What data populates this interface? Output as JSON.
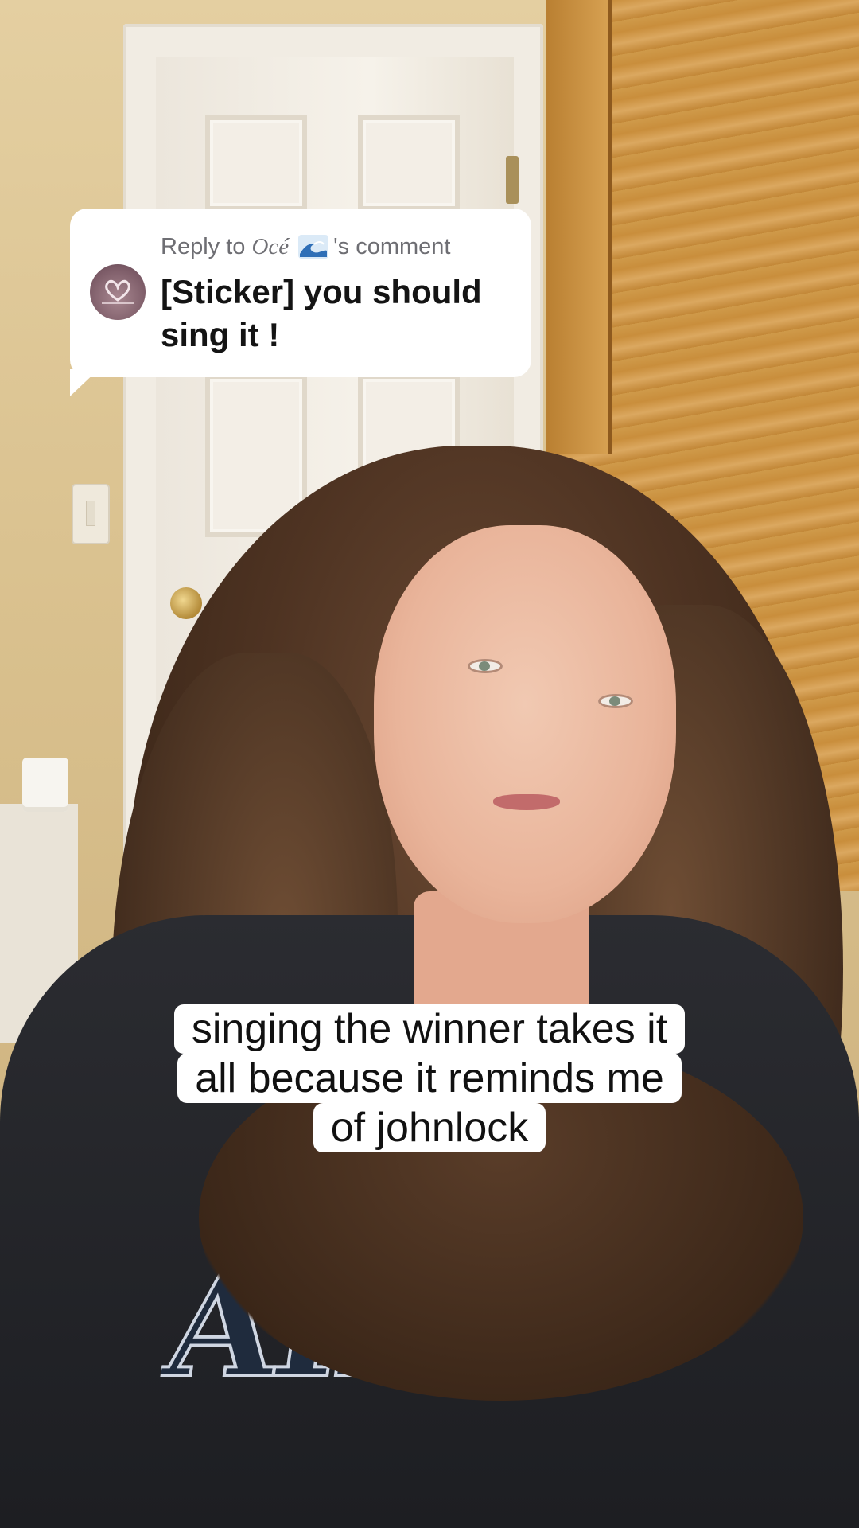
{
  "reply_card": {
    "prefix": "Reply to ",
    "username": "Océ",
    "suffix": "'s comment",
    "avatar_icon": "swans-heart-icon",
    "username_emoji_icon": "wave-emoji-icon",
    "comment_text": "[Sticker] you should sing it !"
  },
  "caption": {
    "lines": [
      "singing the winner takes it",
      "all because it reminds me",
      "of johnlock"
    ]
  },
  "colors": {
    "bubble_bg": "#ffffff",
    "caption_bg": "#ffffff",
    "caption_text": "#111111",
    "reply_meta_text": "#6e6e73"
  }
}
